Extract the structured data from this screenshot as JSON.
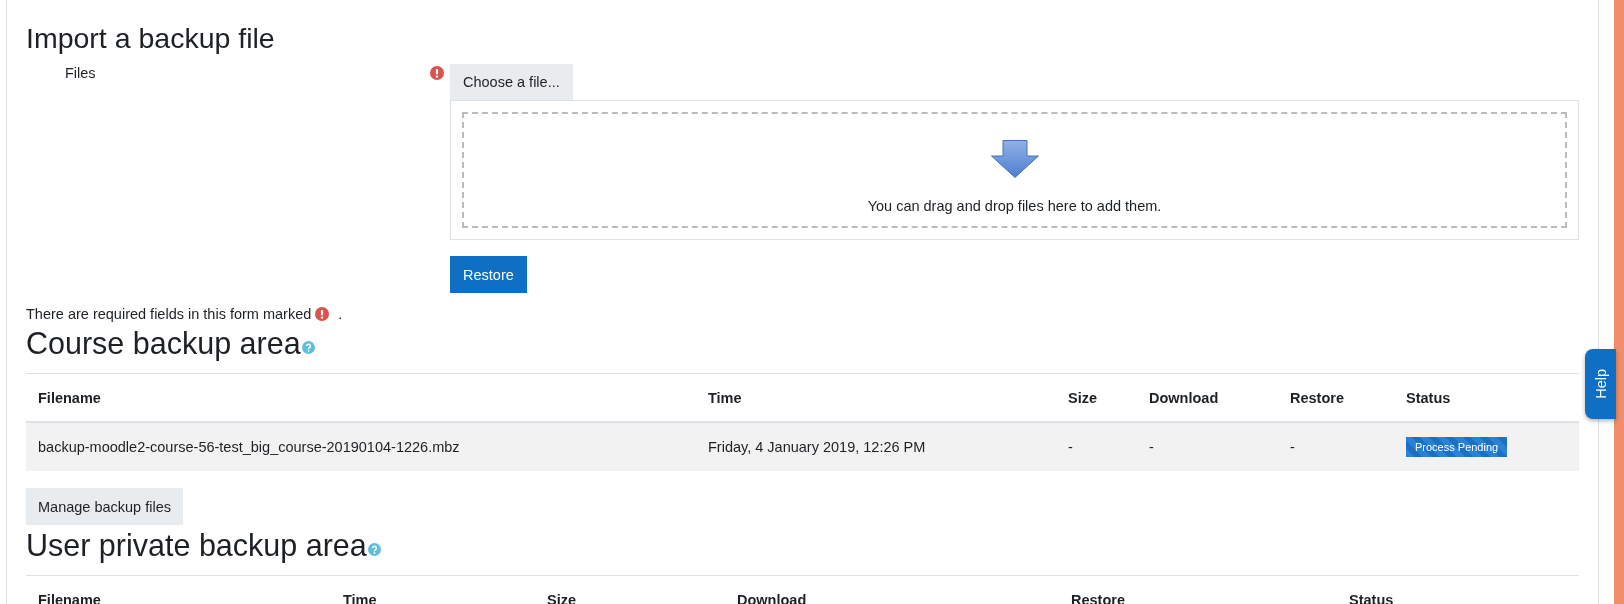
{
  "title": "Import a backup file",
  "form": {
    "label": "Files",
    "required": true,
    "choose_button": "Choose a file...",
    "dropzone_text": "You can drag and drop files here to add them.",
    "submit": "Restore",
    "required_note": "There are required fields in this form marked",
    "required_note_end": "."
  },
  "sections": [
    {
      "heading": "Course backup area",
      "help": true,
      "columns": [
        "Filename",
        "Time",
        "Size",
        "Download",
        "Restore",
        "Status"
      ],
      "rows": [
        {
          "cells": [
            "backup-moodle2-course-56-test_big_course-20190104-1226.mbz",
            "Friday, 4 January 2019, 12:26 PM",
            "-",
            "-",
            "-"
          ],
          "status": "Process Pending"
        }
      ],
      "button": "Manage backup files"
    },
    {
      "heading": "User private backup area",
      "help": true,
      "columns": [
        "Filename",
        "Time",
        "Size",
        "Download",
        "Restore",
        "Status"
      ]
    }
  ],
  "help_tab": "Help"
}
